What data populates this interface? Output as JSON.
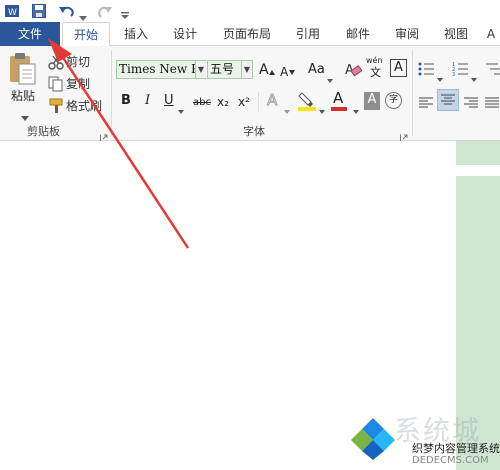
{
  "tabs": {
    "file": "文件",
    "home": "开始",
    "insert": "插入",
    "design": "设计",
    "layout": "页面布局",
    "references": "引用",
    "mailings": "邮件",
    "review": "审阅",
    "view": "视图",
    "more": "A"
  },
  "clipboard": {
    "paste": "粘贴",
    "cut": "剪切",
    "copy": "复制",
    "format_painter": "格式刷",
    "group_label": "剪贴板"
  },
  "font": {
    "name": "Times New R",
    "size": "五号",
    "grow": "A",
    "shrink": "A",
    "case": "Aa",
    "pinyin_top": "wén",
    "pinyin_bottom": "文",
    "char_border": "A",
    "bold": "B",
    "italic": "I",
    "underline": "U",
    "strike": "abc",
    "sub": "x₂",
    "sup": "x²",
    "effects": "A",
    "font_color": "A",
    "char_shading": "A",
    "enclose": "字",
    "group_label": "字体"
  },
  "watermark": {
    "text": "织梦内容管理系统",
    "url": "DEDECMS.COM",
    "cn": "系统城"
  },
  "colors": {
    "file_tab": "#2b579a",
    "highlight": "#f5e50a",
    "font_red": "#d32f2f",
    "arrow": "#e53935"
  }
}
